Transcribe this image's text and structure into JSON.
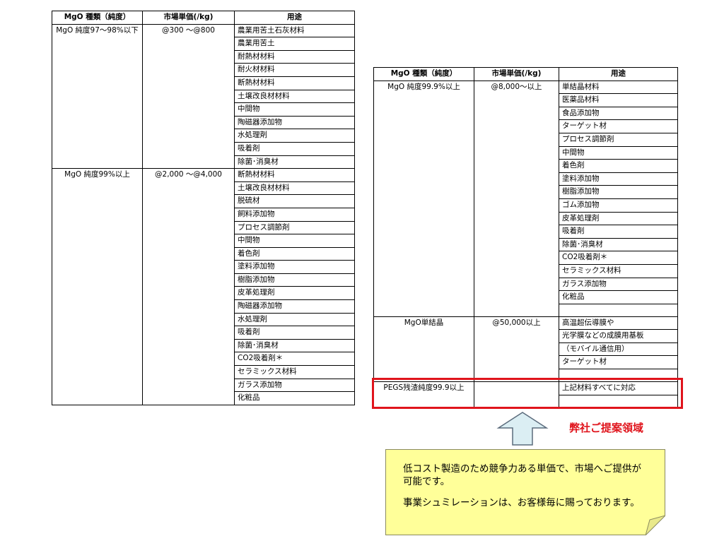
{
  "headers": {
    "type": "MgO 種類（純度）",
    "price": "市場単価(/kg)",
    "use": "用途"
  },
  "left_table": {
    "groups": [
      {
        "type": "MgO 純度97～98%以下",
        "price": "@300 ～@800",
        "uses": [
          "農業用苦土石灰材料",
          "農業用苦土",
          "耐熱材材料",
          "耐火材材料",
          "断熱材材料",
          "土壌改良材材料",
          "中間物",
          "陶磁器添加物",
          "水処理剤",
          "吸着剤",
          "除菌･消臭材"
        ]
      },
      {
        "type": "MgO 純度99%以上",
        "price": "@2,000 ～@4,000",
        "uses": [
          "断熱材材料",
          "土壌改良材材料",
          "脱硫材",
          "飼料添加物",
          "プロセス調節剤",
          "中間物",
          "着色剤",
          "塗料添加物",
          "樹脂添加物",
          "皮革処理剤",
          "陶磁器添加物",
          "水処理剤",
          "吸着剤",
          "除菌･消臭材",
          "CO2吸着剤＊",
          "セラミックス材料",
          "ガラス添加物",
          "化粧品"
        ]
      }
    ]
  },
  "right_table": {
    "groups": [
      {
        "type": "MgO 純度99.9%以上",
        "price": "@8,000～以上",
        "uses": [
          "単結晶材料",
          "医薬品材料",
          "食品添加物",
          "ターゲット材",
          "プロセス調節剤",
          "中間物",
          "着色剤",
          "塗料添加物",
          "樹脂添加物",
          "ゴム添加物",
          "皮革処理剤",
          "吸着剤",
          "除菌･消臭材",
          "CO2吸着剤＊",
          "セラミックス材料",
          "ガラス添加物",
          "化粧品",
          ""
        ]
      },
      {
        "type": "MgO単結晶",
        "price": "@50,000以上",
        "uses": [
          "高温超伝導膜や",
          "光学膜などの成膜用基板",
          "（モバイル通信用）",
          "ターゲット材",
          ""
        ]
      },
      {
        "type": "PEGS残渣純度99.9以上",
        "price": "",
        "uses": [
          "上記材料すべてに対応",
          ""
        ]
      }
    ]
  },
  "proposal_label": "弊社ご提案領域",
  "note": {
    "p1": "低コスト製造のため競争力ある単価で、市場へご提供が可能です。",
    "p2": "事業シュミレーションは、お客様毎に賜っております。"
  },
  "colors": {
    "highlight": "#e0141c",
    "note_bg": "#ffff99",
    "arrow_fill": "#dbeef3"
  }
}
